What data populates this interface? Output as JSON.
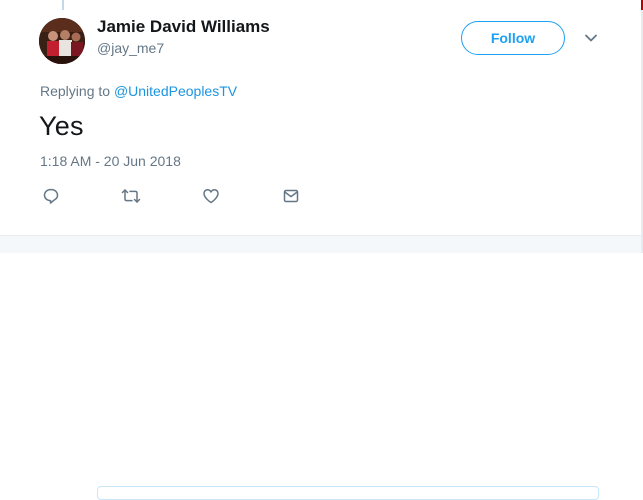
{
  "author": {
    "name": "Jamie David Williams",
    "handle": "@jay_me7",
    "avatar_icon": "avatar-photo"
  },
  "follow_label": "Follow",
  "reply_context": {
    "prefix": "Replying to",
    "mention": "@UnitedPeoplesTV"
  },
  "tweet_text": "Yes",
  "timestamp": "1:18 AM - 20 Jun 2018",
  "actions": {
    "reply_icon": "reply-icon",
    "retweet_icon": "retweet-icon",
    "like_icon": "heart-icon",
    "dm_icon": "envelope-icon"
  },
  "colors": {
    "accent": "#1da1f2",
    "mention": "#1b95e0",
    "secondary_text": "#657786",
    "primary_text": "#14171a"
  }
}
